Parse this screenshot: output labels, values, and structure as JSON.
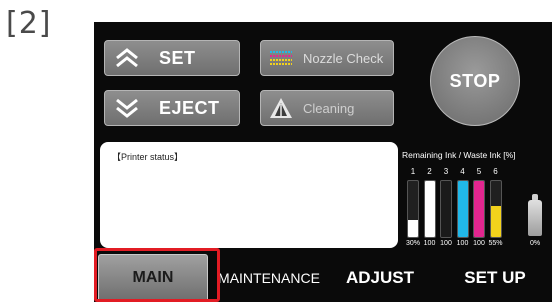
{
  "step_label": "[2]",
  "buttons": {
    "set": "SET",
    "eject": "EJECT",
    "nozzle_check": "Nozzle Check",
    "cleaning": "Cleaning",
    "stop": "STOP"
  },
  "status": {
    "title": "【Printer status】"
  },
  "ink": {
    "title": "Remaining Ink / Waste Ink [%]",
    "cartridges": [
      {
        "num": "1",
        "pct": "30%",
        "level": 0.3,
        "color": "#ffffff"
      },
      {
        "num": "2",
        "pct": "100",
        "level": 1.0,
        "color": "#ffffff"
      },
      {
        "num": "3",
        "pct": "100",
        "level": 1.0,
        "color": "#1a1a1a"
      },
      {
        "num": "4",
        "pct": "100",
        "level": 1.0,
        "color": "#21b8e8"
      },
      {
        "num": "5",
        "pct": "100",
        "level": 1.0,
        "color": "#e3268f"
      },
      {
        "num": "6",
        "pct": "55%",
        "level": 0.55,
        "color": "#f2d21c"
      }
    ],
    "waste_pct": "0%"
  },
  "tabs": {
    "main": "MAIN",
    "maintenance": "MAINTENANCE",
    "adjust": "ADJUST",
    "setup": "SET UP"
  },
  "colors": {
    "panel_bg": "#0a0a0a",
    "button_gray": "#7f7f7f",
    "highlight": "#e21c24"
  }
}
